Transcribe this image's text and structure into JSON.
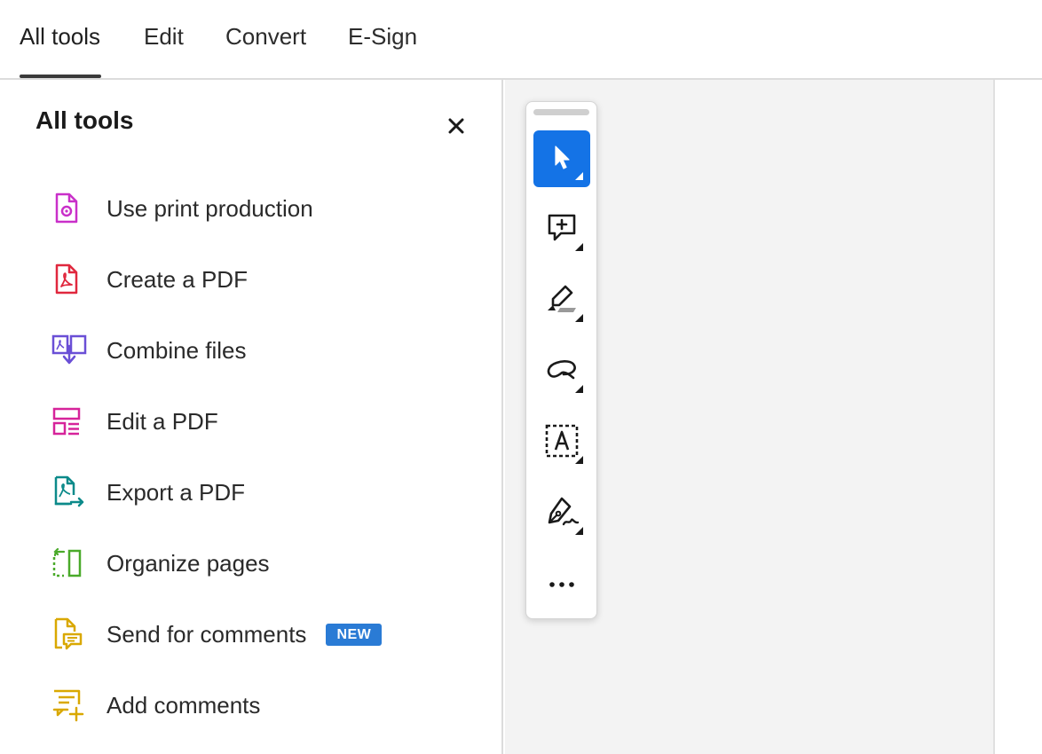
{
  "tabs": [
    {
      "label": "All tools",
      "active": true
    },
    {
      "label": "Edit",
      "active": false
    },
    {
      "label": "Convert",
      "active": false
    },
    {
      "label": "E-Sign",
      "active": false
    }
  ],
  "panel": {
    "title": "All tools",
    "close_icon": "close-icon",
    "items": [
      {
        "label": "Use print production",
        "icon": "print-production-icon",
        "color": "#c930c9"
      },
      {
        "label": "Create a PDF",
        "icon": "create-pdf-icon",
        "color": "#e0283e"
      },
      {
        "label": "Combine files",
        "icon": "combine-files-icon",
        "color": "#6a4fd6"
      },
      {
        "label": "Edit a PDF",
        "icon": "edit-pdf-icon",
        "color": "#d6239a"
      },
      {
        "label": "Export a PDF",
        "icon": "export-pdf-icon",
        "color": "#0c8a8a"
      },
      {
        "label": "Organize pages",
        "icon": "organize-pages-icon",
        "color": "#4aaa2a"
      },
      {
        "label": "Send for comments",
        "icon": "send-comments-icon",
        "color": "#d9a800",
        "badge": "NEW"
      },
      {
        "label": "Add comments",
        "icon": "add-comments-icon",
        "color": "#d9a800"
      }
    ]
  },
  "quick_toolbar": {
    "tools": [
      {
        "name": "select",
        "icon": "cursor-arrow-icon",
        "selected": true
      },
      {
        "name": "comment",
        "icon": "add-comment-icon",
        "selected": false
      },
      {
        "name": "highlight",
        "icon": "highlighter-icon",
        "selected": false
      },
      {
        "name": "draw",
        "icon": "freehand-draw-icon",
        "selected": false
      },
      {
        "name": "text",
        "icon": "text-box-icon",
        "selected": false
      },
      {
        "name": "sign",
        "icon": "sign-pen-icon",
        "selected": false
      }
    ],
    "more_label": "...",
    "accent_color": "#1473e6"
  }
}
